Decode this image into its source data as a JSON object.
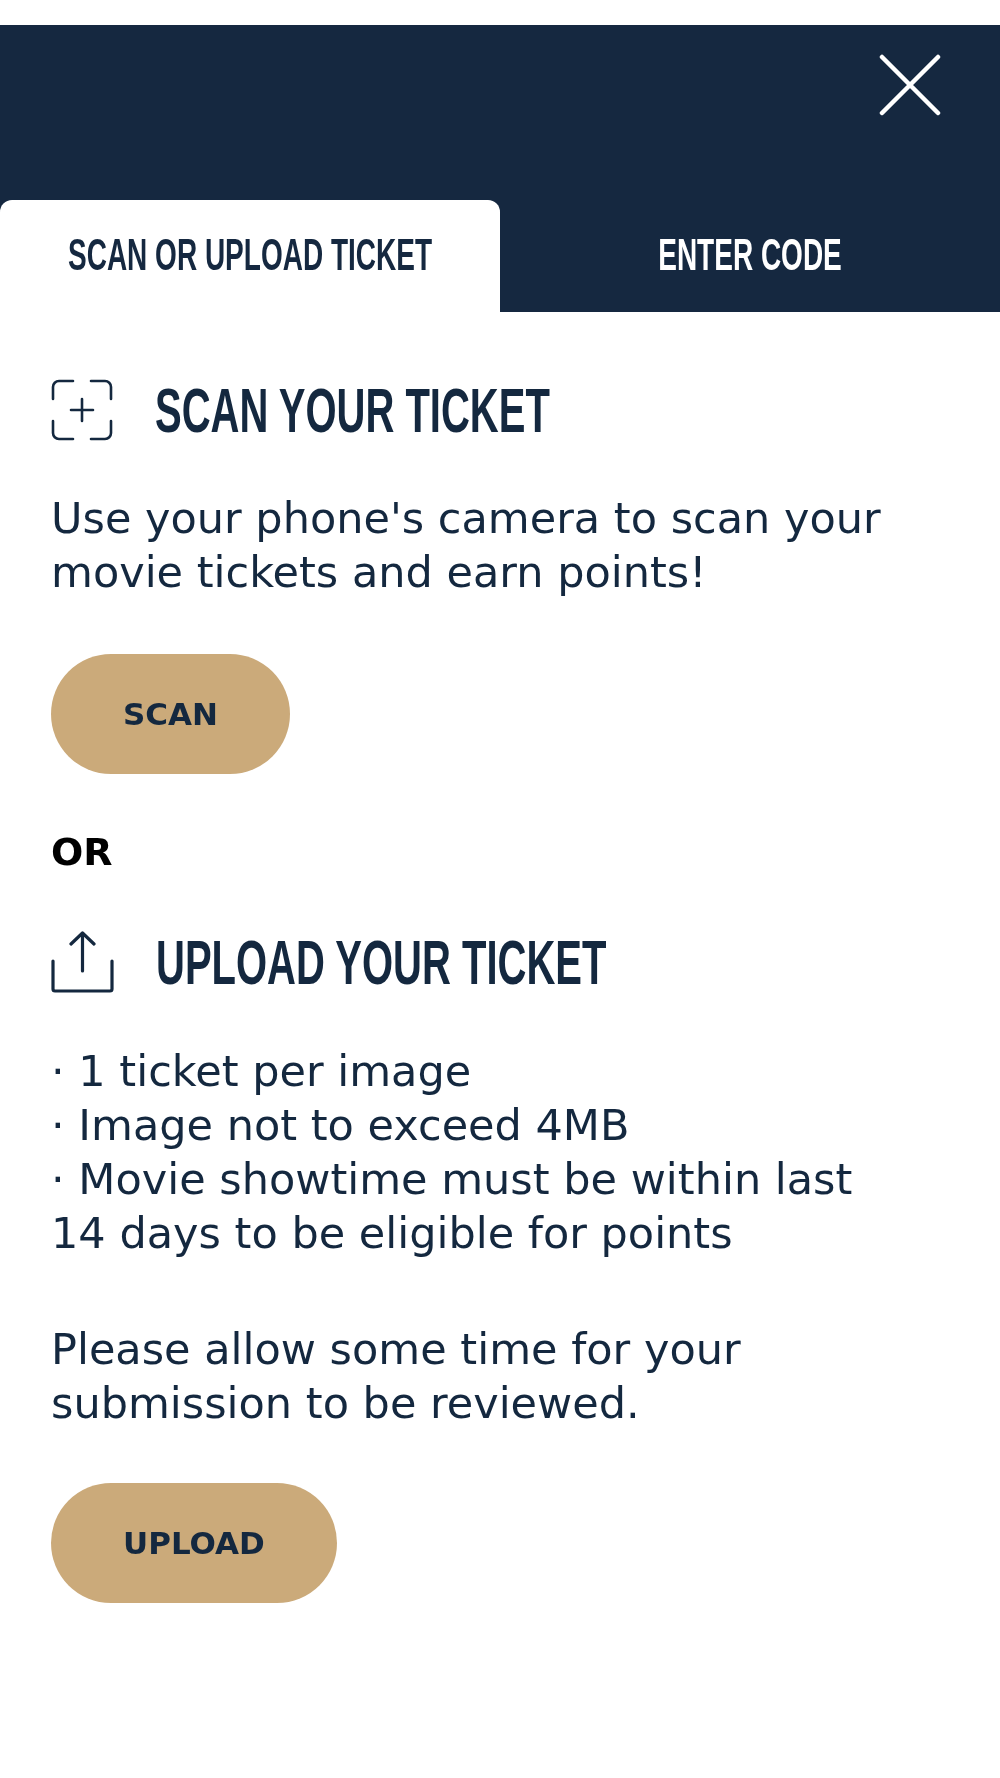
{
  "header": {
    "tabs": [
      {
        "label": "SCAN OR UPLOAD TICKET",
        "selected": true
      },
      {
        "label": "ENTER CODE",
        "selected": false
      }
    ]
  },
  "scan": {
    "title": "SCAN YOUR TICKET",
    "description": "Use your phone's camera to scan your movie tickets and earn points!",
    "button": "SCAN"
  },
  "separator": "OR",
  "upload": {
    "title": "UPLOAD YOUR TICKET",
    "rules": [
      "· 1 ticket per image",
      "· Image not to exceed 4MB",
      "· Movie showtime must be within last 14 days to be eligible for points"
    ],
    "note": "Please allow some time for your submission to be reviewed.",
    "button": "UPLOAD"
  }
}
